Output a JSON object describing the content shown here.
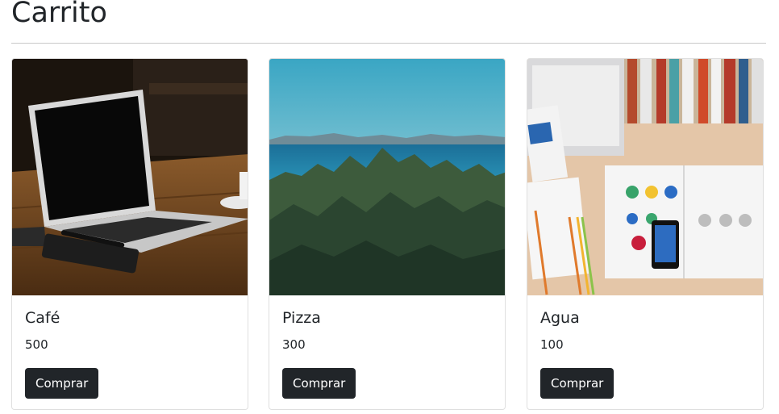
{
  "page": {
    "title": "Carrito"
  },
  "products": [
    {
      "name": "Café",
      "price": "500",
      "button_label": "Comprar",
      "image": "laptop-on-wooden-table-photo"
    },
    {
      "name": "Pizza",
      "price": "300",
      "button_label": "Comprar",
      "image": "forest-lake-mountains-photo"
    },
    {
      "name": "Agua",
      "price": "100",
      "button_label": "Comprar",
      "image": "desk-books-laptop-magazine-photo"
    }
  ],
  "colors": {
    "text": "#212529",
    "button_bg": "#212529",
    "button_text": "#ffffff",
    "card_border": "#dfdfdf",
    "divider": "#c8c8c8"
  }
}
